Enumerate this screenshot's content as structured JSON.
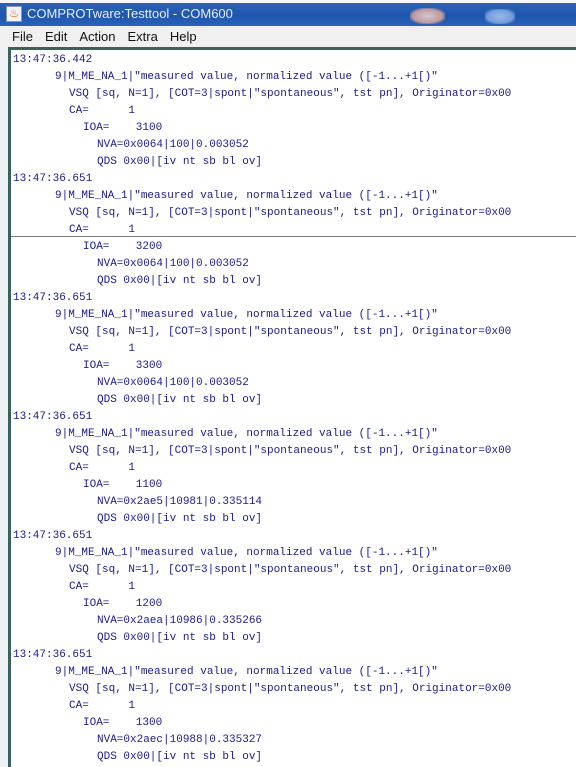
{
  "window": {
    "title": "COMPROTware:Testtool - COM600",
    "icon": "java-cup-icon"
  },
  "menubar": {
    "items": [
      "File",
      "Edit",
      "Action",
      "Extra",
      "Help"
    ]
  },
  "colors": {
    "text": "#1b1b88",
    "titlebar": "#1e56ae",
    "pane_border": "#37635a"
  },
  "log": {
    "entries": [
      {
        "time": "13:47:36.442",
        "type": "9|M_ME_NA_1|\"measured value, normalized value ([-1...+1[)\"",
        "vsq": "VSQ [sq, N=1], [COT=3|spont|\"spontaneous\", tst pn], Originator=0x00",
        "ca": "CA=      1",
        "ioa": "IOA=    3100",
        "nva": "NVA=0x0064|100|0.003052",
        "qds": "QDS 0x00|[iv nt sb bl ov]"
      },
      {
        "time": "13:47:36.651",
        "type": "9|M_ME_NA_1|\"measured value, normalized value ([-1...+1[)\"",
        "vsq": "VSQ [sq, N=1], [COT=3|spont|\"spontaneous\", tst pn], Originator=0x00",
        "ca": "CA=      1",
        "ioa": "IOA=    3200",
        "nva": "NVA=0x0064|100|0.003052",
        "qds": "QDS 0x00|[iv nt sb bl ov]"
      },
      {
        "time": "13:47:36.651",
        "type": "9|M_ME_NA_1|\"measured value, normalized value ([-1...+1[)\"",
        "vsq": "VSQ [sq, N=1], [COT=3|spont|\"spontaneous\", tst pn], Originator=0x00",
        "ca": "CA=      1",
        "ioa": "IOA=    3300",
        "nva": "NVA=0x0064|100|0.003052",
        "qds": "QDS 0x00|[iv nt sb bl ov]"
      },
      {
        "time": "13:47:36.651",
        "type": "9|M_ME_NA_1|\"measured value, normalized value ([-1...+1[)\"",
        "vsq": "VSQ [sq, N=1], [COT=3|spont|\"spontaneous\", tst pn], Originator=0x00",
        "ca": "CA=      1",
        "ioa": "IOA=    1100",
        "nva": "NVA=0x2ae5|10981|0.335114",
        "qds": "QDS 0x00|[iv nt sb bl ov]"
      },
      {
        "time": "13:47:36.651",
        "type": "9|M_ME_NA_1|\"measured value, normalized value ([-1...+1[)\"",
        "vsq": "VSQ [sq, N=1], [COT=3|spont|\"spontaneous\", tst pn], Originator=0x00",
        "ca": "CA=      1",
        "ioa": "IOA=    1200",
        "nva": "NVA=0x2aea|10986|0.335266",
        "qds": "QDS 0x00|[iv nt sb bl ov]"
      },
      {
        "time": "13:47:36.651",
        "type": "9|M_ME_NA_1|\"measured value, normalized value ([-1...+1[)\"",
        "vsq": "VSQ [sq, N=1], [COT=3|spont|\"spontaneous\", tst pn], Originator=0x00",
        "ca": "CA=      1",
        "ioa": "IOA=    1300",
        "nva": "NVA=0x2aec|10988|0.335327",
        "qds": "QDS 0x00|[iv nt sb bl ov]"
      }
    ]
  }
}
